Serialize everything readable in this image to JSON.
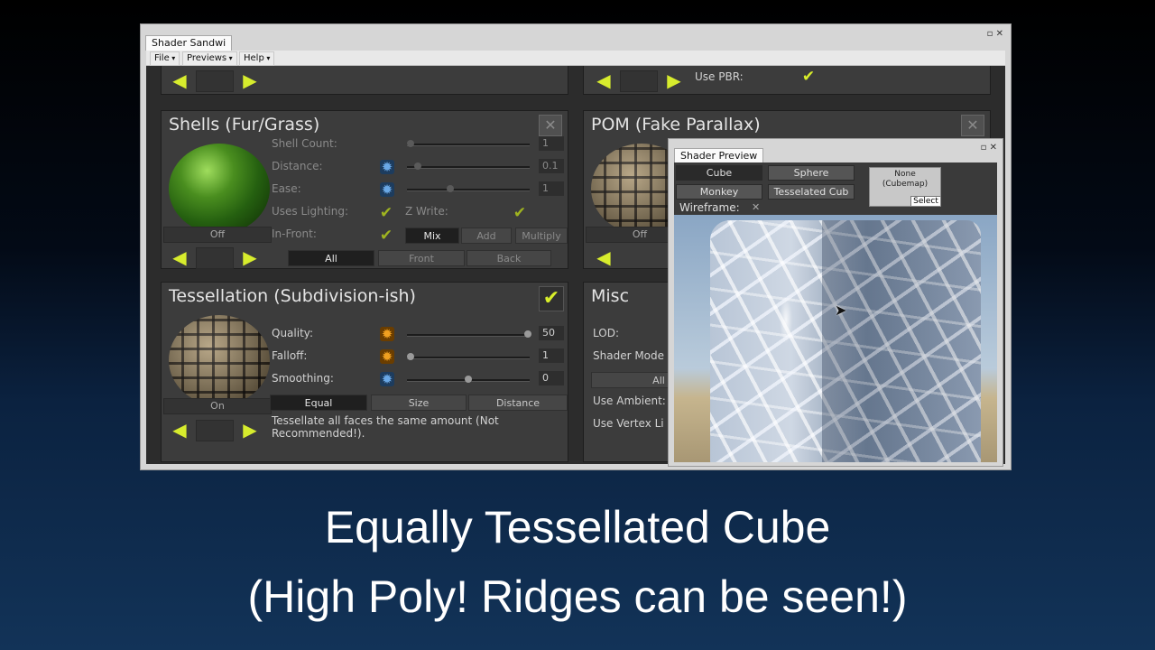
{
  "window": {
    "title": "Shader Sandwi",
    "controls": "▫ ✕"
  },
  "menu": [
    "File",
    "Previews",
    "Help"
  ],
  "top_row": {
    "use_pbr_label": "Use PBR:"
  },
  "shells": {
    "title": "Shells (Fur/Grass)",
    "preview_label": "Off",
    "shell_count_label": "Shell Count:",
    "shell_count_value": "1",
    "distance_label": "Distance:",
    "distance_value": "0.1",
    "ease_label": "Ease:",
    "ease_value": "1",
    "uses_lighting_label": "Uses Lighting:",
    "z_write_label": "Z Write:",
    "in_front_label": "In-Front:",
    "blend_modes": [
      "Mix",
      "Add",
      "Multiply"
    ],
    "faces": [
      "All",
      "Front",
      "Back"
    ]
  },
  "pom": {
    "title": "POM (Fake Parallax)",
    "preview_label": "Off"
  },
  "tessellation": {
    "title": "Tessellation (Subdivision-ish)",
    "preview_label": "On",
    "quality_label": "Quality:",
    "quality_value": "50",
    "falloff_label": "Falloff:",
    "falloff_value": "1",
    "smoothing_label": "Smoothing:",
    "smoothing_value": "0",
    "modes": [
      "Equal",
      "Size",
      "Distance"
    ],
    "description": "Tessellate all faces the same amount (Not Recommended!)."
  },
  "misc": {
    "title": "Misc",
    "lod_label": "LOD:",
    "shader_model_label": "Shader Mode",
    "all_button": "All",
    "use_ambient_label": "Use Ambient:",
    "use_vertex_label": "Use Vertex Li"
  },
  "preview": {
    "title": "Shader Preview",
    "controls": "▫ ✕",
    "shapes": [
      "Cube",
      "Sphere",
      "Monkey",
      "Tesselated Cub"
    ],
    "cubemap_line1": "None",
    "cubemap_line2": "(Cubemap)",
    "select_label": "Select",
    "wireframe_label": "Wireframe:",
    "wireframe_mark": "✕"
  },
  "caption": {
    "line1": "Equally Tessellated Cube",
    "line2": "(High Poly! Ridges can be seen!)"
  },
  "colors": {
    "accent_check": "#d8ee2a",
    "gear_orange": "#f0a020",
    "gear_blue": "#6aa8e6"
  },
  "icons": {
    "arrow_left": "arrow-left-icon",
    "arrow_right": "arrow-right-icon",
    "gear": "gear-icon",
    "check": "check-icon",
    "close": "close-icon"
  }
}
